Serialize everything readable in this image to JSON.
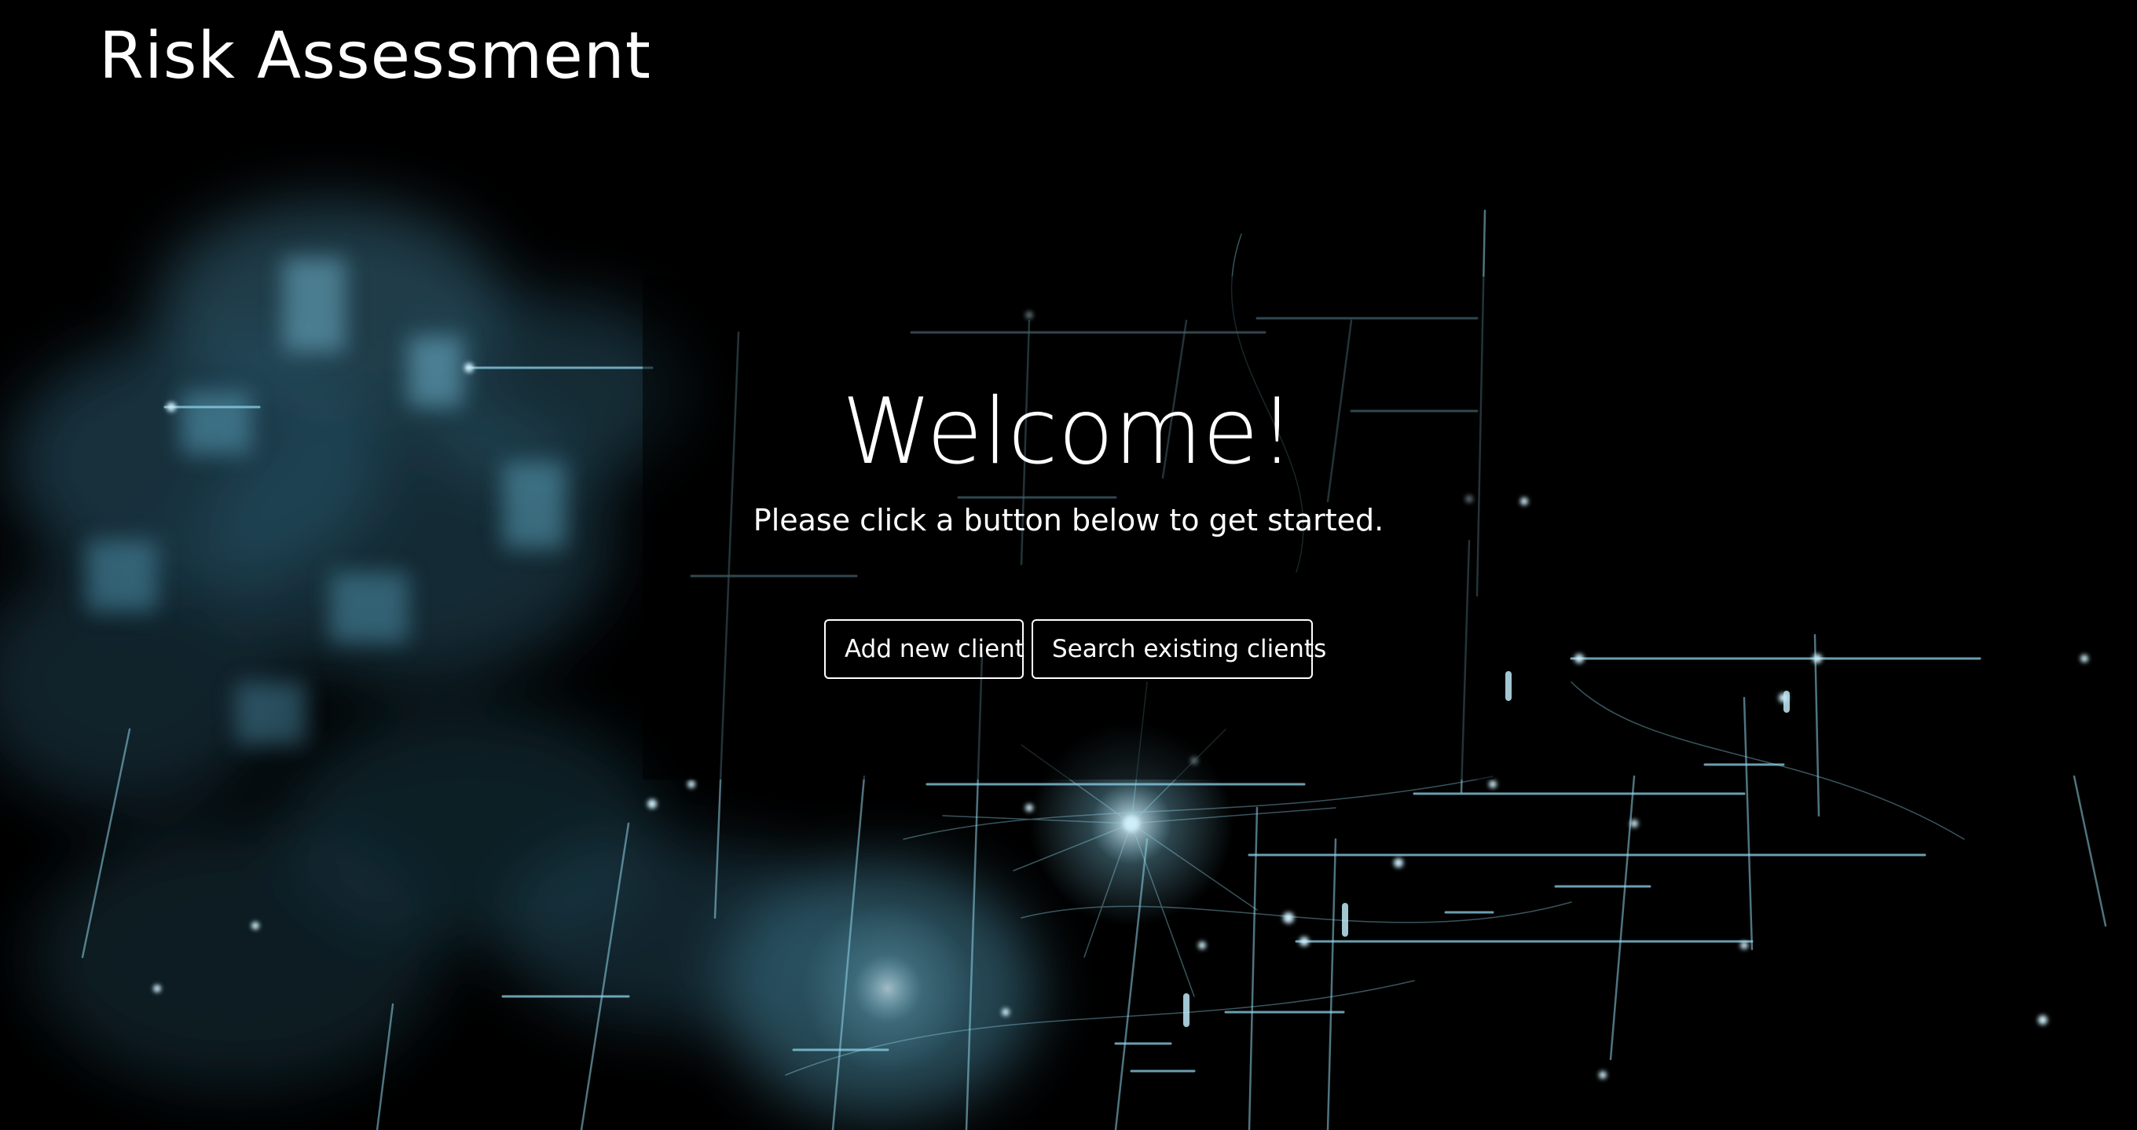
{
  "header": {
    "brand": "Risk Assessment"
  },
  "hero": {
    "title": "Welcome!",
    "subtitle": "Please click a button below to get started.",
    "buttons": {
      "add_client": "Add new client",
      "search_clients": "Search existing clients"
    }
  },
  "colors": {
    "background": "#000000",
    "text": "#ffffff",
    "network_glow": "#7fc8e0"
  }
}
